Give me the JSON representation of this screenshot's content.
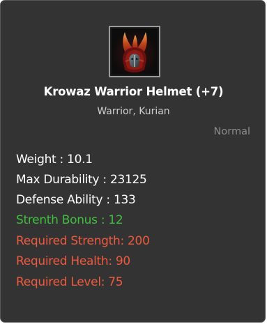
{
  "item": {
    "icon": "krowaz-warrior-helmet-icon",
    "name": "Krowaz Warrior Helmet (+7)",
    "classes": "Warrior, Kurian",
    "grade": "Normal"
  },
  "stats": [
    {
      "text": "Weight : 10.1",
      "color": "#ffffff"
    },
    {
      "text": "Max Durability : 23125",
      "color": "#ffffff"
    },
    {
      "text": "Defense Ability : 133",
      "color": "#ffffff"
    },
    {
      "text": "Strenth Bonus : 12",
      "color": "#3fbf3f"
    },
    {
      "text": "Required Strength: 200",
      "color": "#ee5a3d"
    },
    {
      "text": "Required Health: 90",
      "color": "#ee5a3d"
    },
    {
      "text": "Required Level: 75",
      "color": "#ee5a3d"
    }
  ],
  "colors": {
    "panel_background": "#333333",
    "title": "#ffffff",
    "subtitle": "#cfcfcf",
    "grade": "#8c8c8c",
    "bonus": "#3fbf3f",
    "requirement": "#ee5a3d"
  }
}
